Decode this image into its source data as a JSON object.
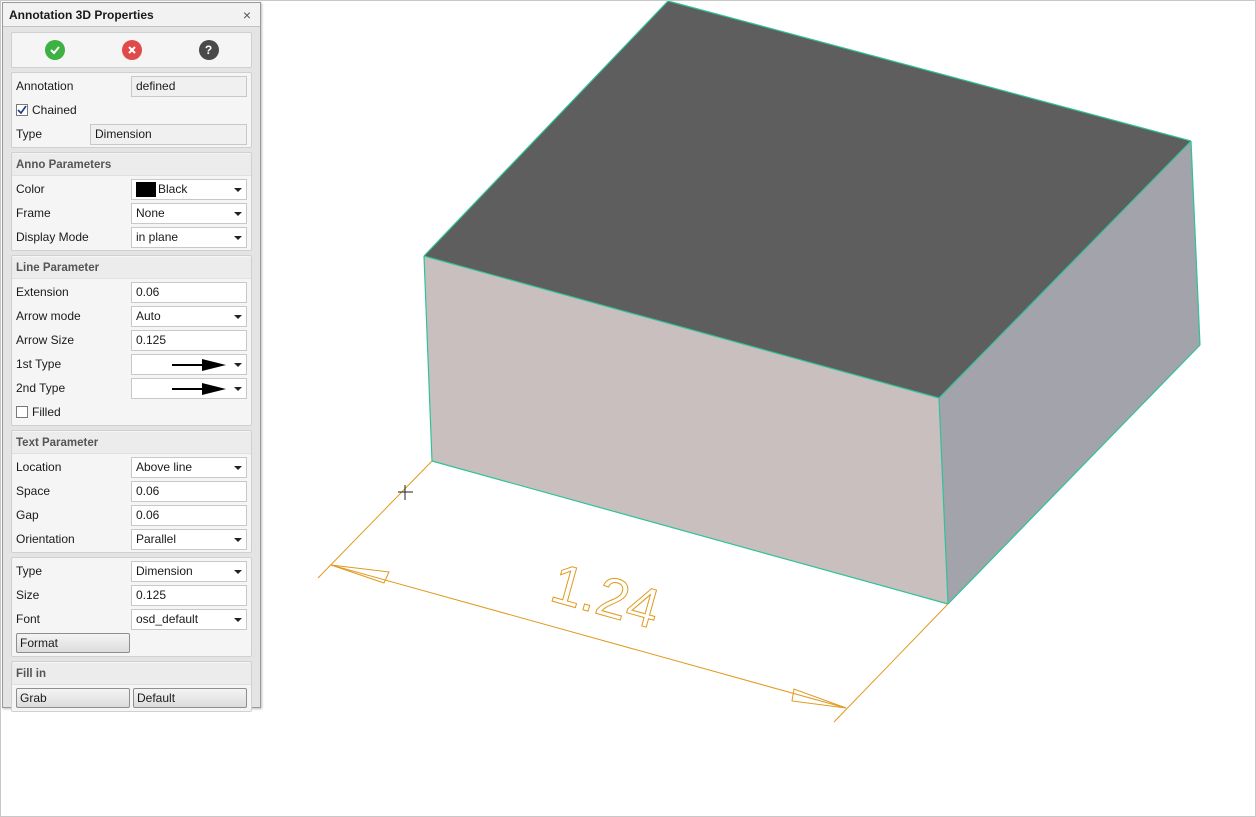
{
  "panel": {
    "title": "Annotation 3D Properties",
    "close": "×",
    "toolbar": {
      "ok_icon": "check-icon",
      "cancel_icon": "cancel-icon",
      "help_icon": "help-icon"
    },
    "annotation": {
      "label": "Annotation",
      "value": "defined"
    },
    "chained": {
      "label": "Chained",
      "checked": true
    },
    "type": {
      "label": "Type",
      "value": "Dimension"
    },
    "anno_params": {
      "title": "Anno Parameters",
      "color": {
        "label": "Color",
        "value": "Black",
        "swatch": "#000000"
      },
      "frame": {
        "label": "Frame",
        "value": "None"
      },
      "display_mode": {
        "label": "Display Mode",
        "value": "in plane"
      }
    },
    "line_params": {
      "title": "Line Parameter",
      "extension": {
        "label": "Extension",
        "value": "0.06"
      },
      "arrow_mode": {
        "label": "Arrow mode",
        "value": "Auto"
      },
      "arrow_size": {
        "label": "Arrow Size",
        "value": "0.125"
      },
      "first_type": {
        "label": "1st Type"
      },
      "second_type": {
        "label": "2nd Type"
      },
      "filled": {
        "label": "Filled",
        "checked": false
      }
    },
    "text_params": {
      "title": "Text Parameter",
      "location": {
        "label": "Location",
        "value": "Above line"
      },
      "space": {
        "label": "Space",
        "value": "0.06"
      },
      "gap": {
        "label": "Gap",
        "value": "0.06"
      },
      "orientation": {
        "label": "Orientation",
        "value": "Parallel"
      }
    },
    "text_style": {
      "type": {
        "label": "Type",
        "value": "Dimension"
      },
      "size": {
        "label": "Size",
        "value": "0.125"
      },
      "font": {
        "label": "Font",
        "value": "osd_default"
      },
      "format_button": "Format"
    },
    "fill_in": {
      "title": "Fill in",
      "grab_button": "Grab",
      "default_button": "Default"
    }
  },
  "viewport": {
    "dimension_text": "1.24",
    "colors": {
      "top_face": "#5e5e5e",
      "front_face": "#c9bfbe",
      "side_face": "#a2a3ab",
      "edge": "#2fc29a",
      "dimension": "#e09a1e"
    }
  }
}
